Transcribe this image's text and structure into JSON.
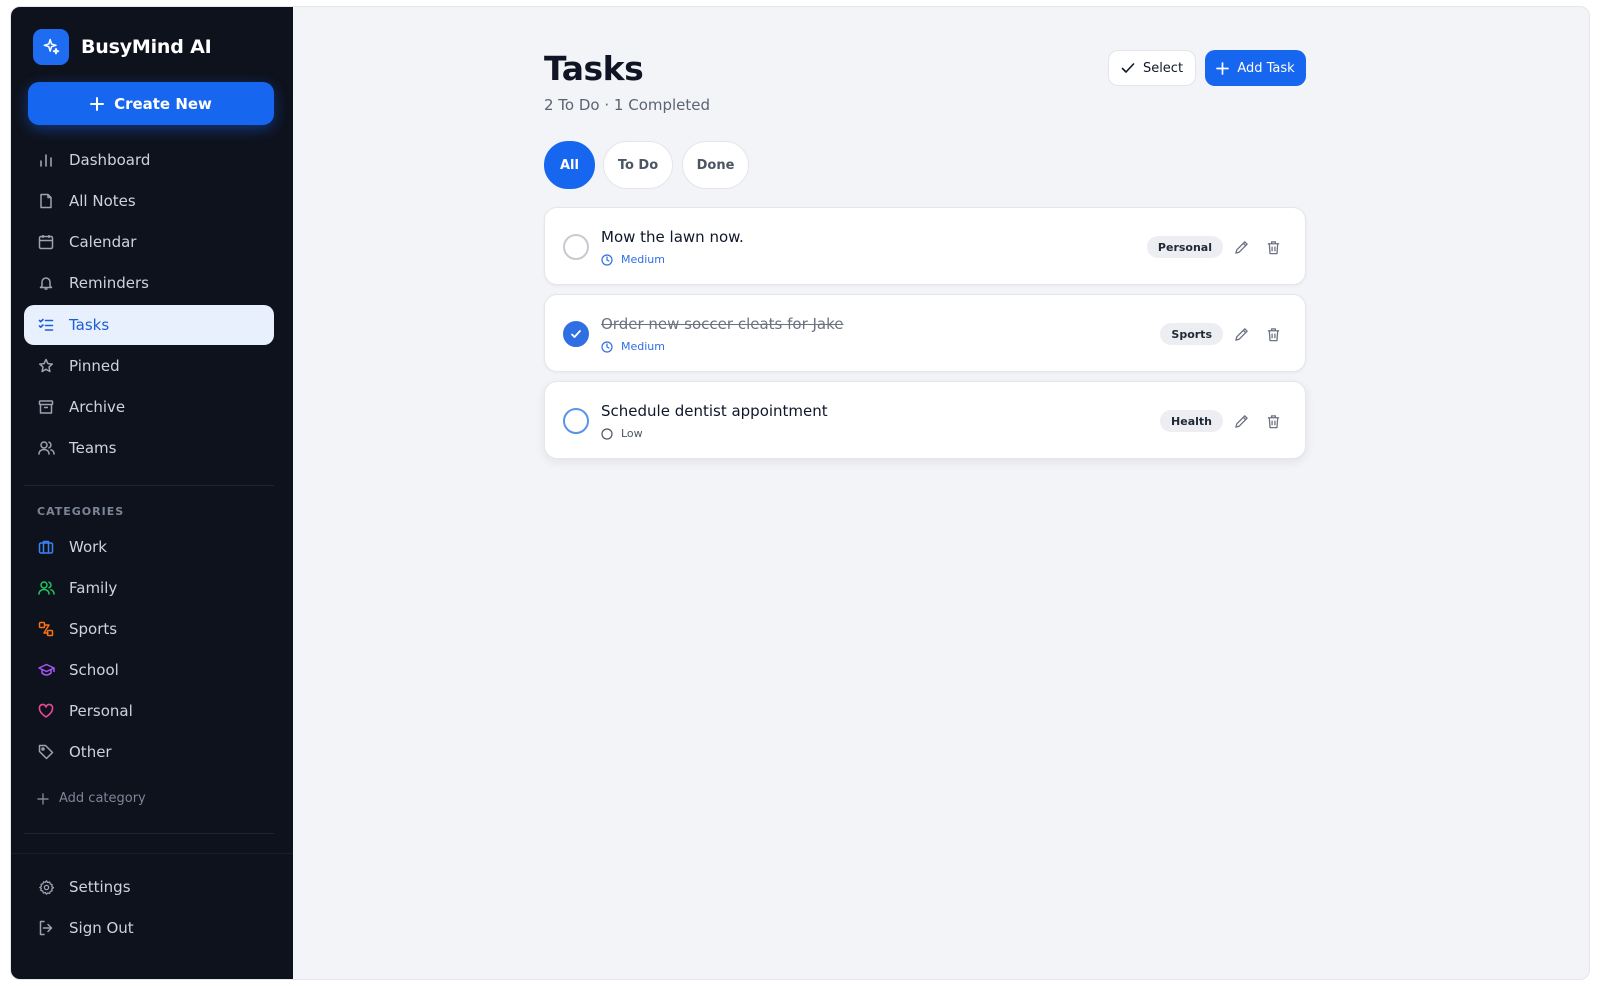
{
  "app": {
    "name": "BusyMind AI"
  },
  "sidebar": {
    "create_label": "Create New",
    "nav": [
      {
        "label": "Dashboard",
        "icon": "bar-chart-icon"
      },
      {
        "label": "All Notes",
        "icon": "note-icon"
      },
      {
        "label": "Calendar",
        "icon": "calendar-icon"
      },
      {
        "label": "Reminders",
        "icon": "bell-icon"
      },
      {
        "label": "Tasks",
        "icon": "checklist-icon",
        "active": true
      },
      {
        "label": "Pinned",
        "icon": "star-icon"
      },
      {
        "label": "Archive",
        "icon": "archive-icon"
      },
      {
        "label": "Teams",
        "icon": "users-icon"
      }
    ],
    "categories_heading": "CATEGORIES",
    "categories": [
      {
        "label": "Work",
        "icon": "briefcase-icon",
        "color": "#3b82f6"
      },
      {
        "label": "Family",
        "icon": "users-icon",
        "color": "#22c55e"
      },
      {
        "label": "Sports",
        "icon": "sports-icon",
        "color": "#f97316"
      },
      {
        "label": "School",
        "icon": "graduation-cap-icon",
        "color": "#a855f7"
      },
      {
        "label": "Personal",
        "icon": "heart-icon",
        "color": "#ec4899"
      },
      {
        "label": "Other",
        "icon": "tag-icon",
        "color": "#9ca3af"
      }
    ],
    "add_category_label": "Add category",
    "footer": [
      {
        "label": "Settings",
        "icon": "gear-icon"
      },
      {
        "label": "Sign Out",
        "icon": "sign-out-icon"
      }
    ]
  },
  "main": {
    "title": "Tasks",
    "subtitle": "2 To Do · 1 Completed",
    "select_label": "Select",
    "add_task_label": "Add Task",
    "filters": [
      {
        "label": "All",
        "active": true
      },
      {
        "label": "To Do",
        "active": false
      },
      {
        "label": "Done",
        "active": false
      }
    ],
    "tasks": [
      {
        "title": "Mow the lawn now.",
        "priority": "Medium",
        "tag": "Personal",
        "completed": false
      },
      {
        "title": "Order new soccer cleats for Jake",
        "priority": "Medium",
        "tag": "Sports",
        "completed": true
      },
      {
        "title": "Schedule dentist appointment",
        "priority": "Low",
        "tag": "Health",
        "completed": false
      }
    ]
  },
  "colors": {
    "accent": "#1766ef",
    "sidebar_bg": "#0e121c",
    "main_bg": "#f3f4f8"
  }
}
